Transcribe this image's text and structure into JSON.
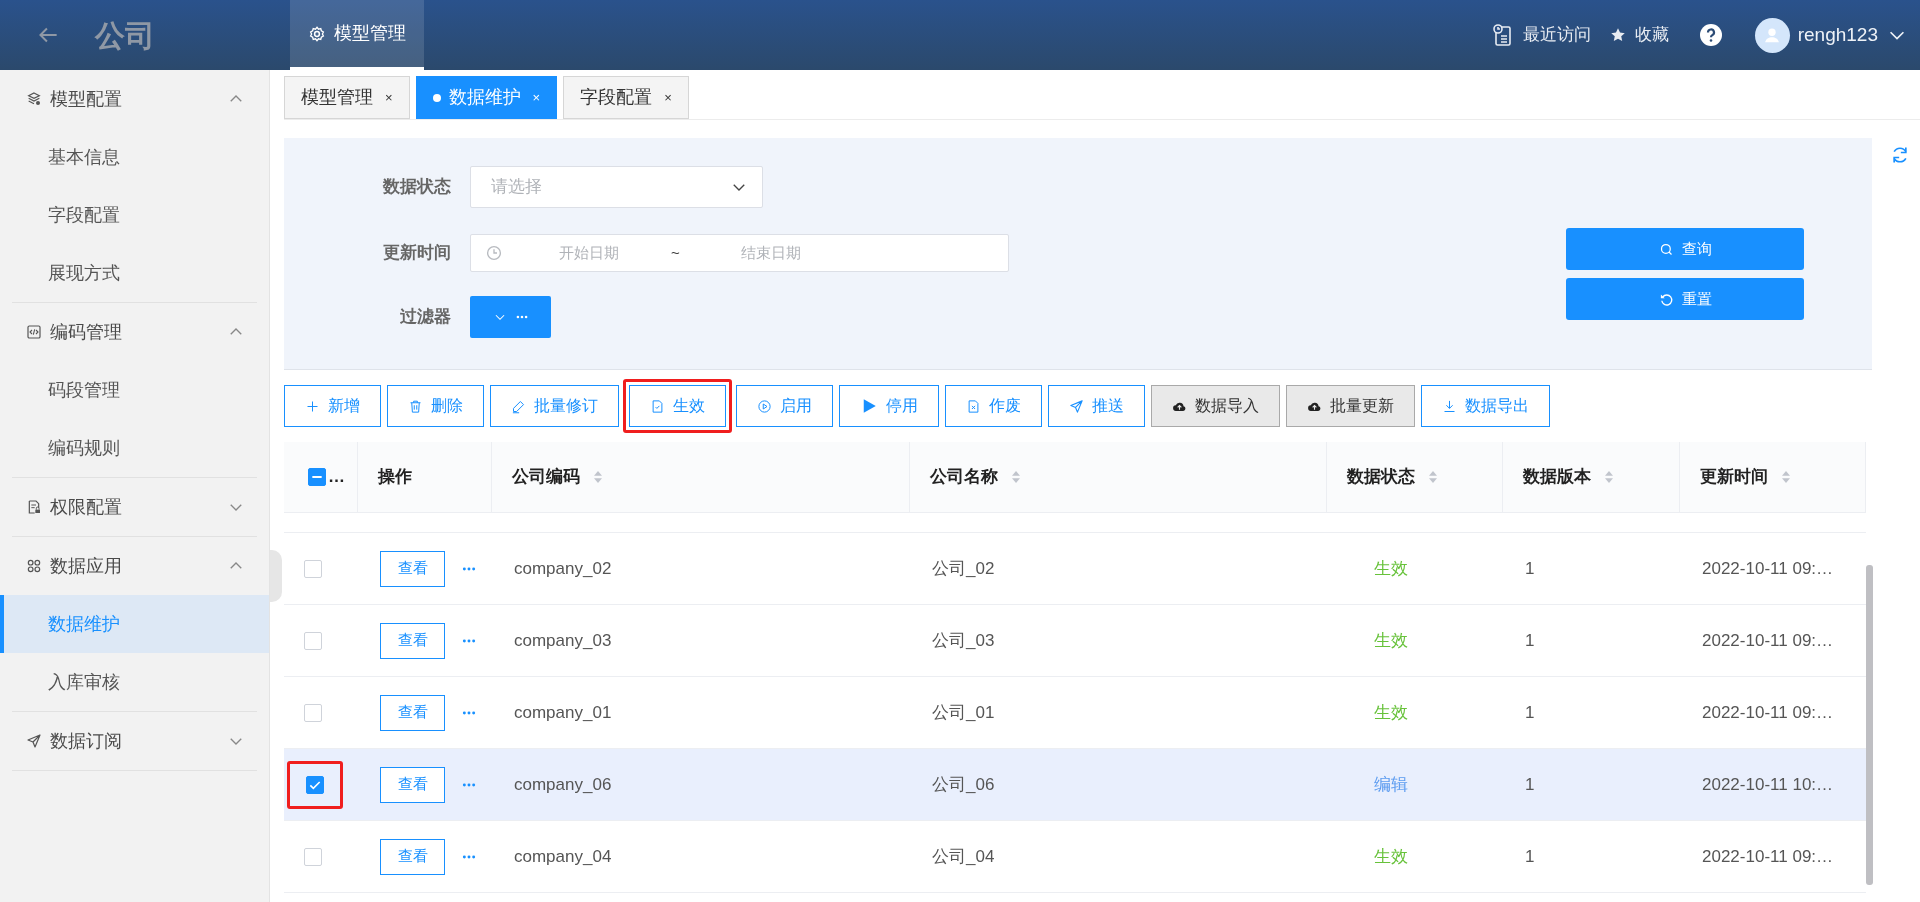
{
  "header": {
    "title": "公司",
    "tabs": [
      {
        "label": "模型管理",
        "selected": true
      }
    ],
    "actions": [
      {
        "kind": "recent",
        "label": "最近访问"
      },
      {
        "kind": "favorite",
        "label": "收藏"
      },
      {
        "kind": "help"
      }
    ],
    "user": {
      "name": "rengh123"
    }
  },
  "sidebar": {
    "groups": [
      {
        "label": "模型配置",
        "expanded": true,
        "children": [
          {
            "label": "基本信息",
            "selected": false
          },
          {
            "label": "字段配置",
            "selected": false
          },
          {
            "label": "展现方式",
            "selected": false
          }
        ]
      },
      {
        "label": "编码管理",
        "expanded": true,
        "children": [
          {
            "label": "码段管理",
            "selected": false
          },
          {
            "label": "编码规则",
            "selected": false
          }
        ]
      },
      {
        "label": "权限配置",
        "expanded": false
      },
      {
        "label": "数据应用",
        "expanded": true,
        "children": [
          {
            "label": "数据维护",
            "selected": true
          },
          {
            "label": "入库审核",
            "selected": false
          }
        ]
      },
      {
        "label": "数据订阅",
        "expanded": false
      }
    ]
  },
  "page_tabs": [
    {
      "label": "模型管理",
      "close": "×",
      "selected": false
    },
    {
      "label": "数据维护",
      "close": "×",
      "selected": true
    },
    {
      "label": "字段配置",
      "close": "×",
      "selected": false
    }
  ],
  "filters": {
    "fields": [
      {
        "kind": "select",
        "label": "数据状态",
        "placeholder": "请选择"
      },
      {
        "kind": "daterange",
        "label": "更新时间",
        "placeholder_start": "开始日期",
        "separator": "~",
        "placeholder_end": "结束日期"
      },
      {
        "kind": "filter",
        "label": "过滤器"
      }
    ],
    "buttons": [
      {
        "kind": "search",
        "label": "查询"
      },
      {
        "kind": "reset",
        "label": "重置"
      }
    ]
  },
  "toolbar": [
    {
      "label": "新增",
      "kind": "outline",
      "highlighted": false
    },
    {
      "label": "删除",
      "kind": "outline",
      "highlighted": false
    },
    {
      "label": "批量修订",
      "kind": "outline",
      "highlighted": false
    },
    {
      "label": "生效",
      "kind": "outline",
      "highlighted": true
    },
    {
      "label": "启用",
      "kind": "outline",
      "highlighted": false
    },
    {
      "label": "停用",
      "kind": "outline",
      "highlighted": false
    },
    {
      "label": "作废",
      "kind": "outline",
      "highlighted": false
    },
    {
      "label": "推送",
      "kind": "outline",
      "highlighted": false
    },
    {
      "label": "数据导入",
      "kind": "gray",
      "highlighted": false
    },
    {
      "label": "批量更新",
      "kind": "gray",
      "highlighted": false
    },
    {
      "label": "数据导出",
      "kind": "outline",
      "highlighted": false
    }
  ],
  "table": {
    "select_all": {
      "indeterminate": true,
      "label": "…"
    },
    "columns": [
      {
        "label": "操作",
        "sortable": false
      },
      {
        "label": "公司编码",
        "sortable": true
      },
      {
        "label": "公司名称",
        "sortable": true
      },
      {
        "label": "数据状态",
        "sortable": true
      },
      {
        "label": "数据版本",
        "sortable": true
      },
      {
        "label": "更新时间",
        "sortable": true
      }
    ],
    "rows": [
      {
        "checked": false,
        "selected": false,
        "highlighted": false,
        "action": "查看",
        "code": "company_02",
        "name": "公司_02",
        "status": {
          "text": "生效",
          "color": "#67c23a"
        },
        "version": "1",
        "updated": "2022-10-11 09:…"
      },
      {
        "checked": false,
        "selected": false,
        "highlighted": false,
        "action": "查看",
        "code": "company_03",
        "name": "公司_03",
        "status": {
          "text": "生效",
          "color": "#67c23a"
        },
        "version": "1",
        "updated": "2022-10-11 09:…"
      },
      {
        "checked": false,
        "selected": false,
        "highlighted": false,
        "action": "查看",
        "code": "company_01",
        "name": "公司_01",
        "status": {
          "text": "生效",
          "color": "#67c23a"
        },
        "version": "1",
        "updated": "2022-10-11 09:…"
      },
      {
        "checked": true,
        "selected": true,
        "highlighted": true,
        "action": "查看",
        "code": "company_06",
        "name": "公司_06",
        "status": {
          "text": "编辑",
          "color": "#5b9bf0"
        },
        "version": "1",
        "updated": "2022-10-11 10:…"
      },
      {
        "checked": false,
        "selected": false,
        "highlighted": false,
        "action": "查看",
        "code": "company_04",
        "name": "公司_04",
        "status": {
          "text": "生效",
          "color": "#67c23a"
        },
        "version": "1",
        "updated": "2022-10-11 09:…"
      }
    ]
  }
}
